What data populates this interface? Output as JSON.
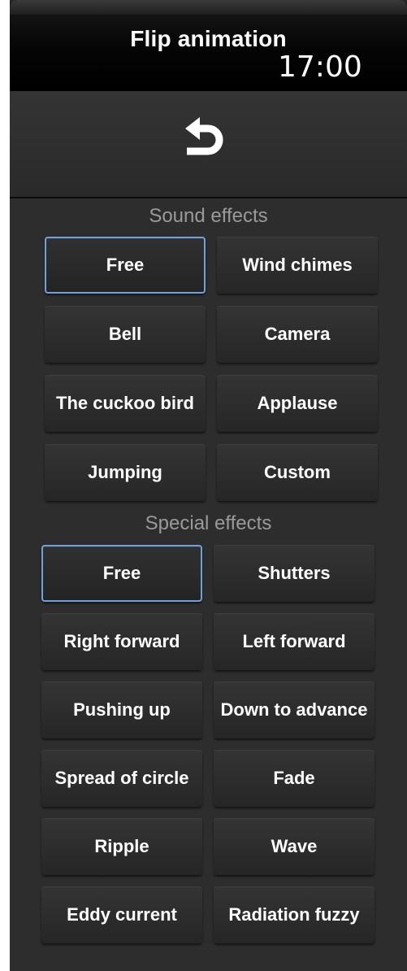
{
  "header": {
    "title": "Flip animation",
    "clock": "17:00"
  },
  "back": {
    "icon": "back-arrow-icon"
  },
  "sound_section": {
    "label": "Sound effects",
    "selected": "Free",
    "options": [
      "Free",
      "Wind chimes",
      "Bell",
      "Camera",
      "The cuckoo bird",
      "Applause",
      "Jumping",
      "Custom"
    ]
  },
  "special_section": {
    "label": "Special effects",
    "selected": "Free",
    "options": [
      "Free",
      "Shutters",
      "Right forward",
      "Left forward",
      "Pushing up",
      "Down to advance",
      "Spread of circle",
      "Fade",
      "Ripple",
      "Wave",
      "Eddy current",
      "Radiation fuzzy"
    ]
  },
  "colors": {
    "selected_border": "#6fa2dc",
    "button_bg": "#2f2f2f",
    "panel_bg": "#2d2d2d",
    "label_text": "#9a9a9a"
  }
}
